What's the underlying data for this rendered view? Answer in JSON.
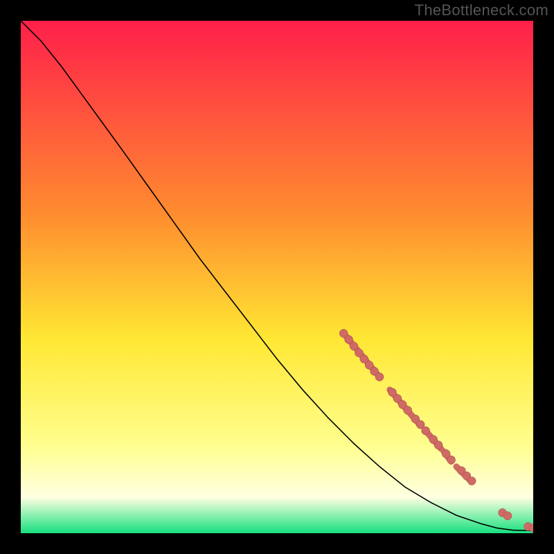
{
  "watermark": "TheBottleneck.com",
  "colors": {
    "background": "#000000",
    "curve": "#000000",
    "point_fill": "#cf6a64",
    "point_stroke": "#9f4e49",
    "grad_top": "#ff1f4a",
    "grad_mid1": "#ff8d2f",
    "grad_mid2": "#ffe733",
    "grad_mid3": "#ffff8f",
    "grad_mid4": "#ffffe2",
    "grad_bottom": "#16e07f"
  },
  "chart_data": {
    "type": "line",
    "title": "",
    "xlabel": "",
    "ylabel": "",
    "xlim": [
      0,
      100
    ],
    "ylim": [
      0,
      100
    ],
    "curve": [
      {
        "x": 0,
        "y": 100
      },
      {
        "x": 4,
        "y": 96
      },
      {
        "x": 8,
        "y": 91
      },
      {
        "x": 12,
        "y": 85.5
      },
      {
        "x": 16,
        "y": 80
      },
      {
        "x": 20,
        "y": 74.5
      },
      {
        "x": 25,
        "y": 67.5
      },
      {
        "x": 30,
        "y": 60.5
      },
      {
        "x": 35,
        "y": 53.5
      },
      {
        "x": 40,
        "y": 47
      },
      {
        "x": 45,
        "y": 40.5
      },
      {
        "x": 50,
        "y": 34
      },
      {
        "x": 55,
        "y": 28
      },
      {
        "x": 60,
        "y": 22.5
      },
      {
        "x": 65,
        "y": 17.5
      },
      {
        "x": 70,
        "y": 13
      },
      {
        "x": 75,
        "y": 9
      },
      {
        "x": 80,
        "y": 6
      },
      {
        "x": 85,
        "y": 3.5
      },
      {
        "x": 90,
        "y": 1.8
      },
      {
        "x": 93,
        "y": 1.0
      },
      {
        "x": 96,
        "y": 0.6
      },
      {
        "x": 100,
        "y": 0.5
      }
    ],
    "curve_thick_segments": [
      {
        "x1": 63,
        "y1": 39,
        "x2": 70,
        "y2": 30.5
      },
      {
        "x1": 72,
        "y1": 28,
        "x2": 78,
        "y2": 21
      },
      {
        "x1": 79,
        "y1": 20,
        "x2": 82,
        "y2": 16.5
      },
      {
        "x1": 82.5,
        "y1": 16,
        "x2": 84,
        "y2": 14
      },
      {
        "x1": 85,
        "y1": 13,
        "x2": 88,
        "y2": 10
      }
    ],
    "points": [
      {
        "x": 63,
        "y": 39
      },
      {
        "x": 64,
        "y": 37.8
      },
      {
        "x": 65,
        "y": 36.5
      },
      {
        "x": 66,
        "y": 35.2
      },
      {
        "x": 67,
        "y": 34
      },
      {
        "x": 68,
        "y": 32.8
      },
      {
        "x": 69,
        "y": 31.6
      },
      {
        "x": 70,
        "y": 30.5
      },
      {
        "x": 72.5,
        "y": 27.5
      },
      {
        "x": 73.5,
        "y": 26.3
      },
      {
        "x": 74.5,
        "y": 25.1
      },
      {
        "x": 75.5,
        "y": 24
      },
      {
        "x": 77,
        "y": 22.3
      },
      {
        "x": 78,
        "y": 21.2
      },
      {
        "x": 79,
        "y": 20
      },
      {
        "x": 80.5,
        "y": 18.3
      },
      {
        "x": 81.5,
        "y": 17.2
      },
      {
        "x": 83,
        "y": 15.5
      },
      {
        "x": 84,
        "y": 14.3
      },
      {
        "x": 86,
        "y": 12.2
      },
      {
        "x": 87,
        "y": 11.2
      },
      {
        "x": 88,
        "y": 10.2
      },
      {
        "x": 94,
        "y": 4.0
      },
      {
        "x": 95,
        "y": 3.4
      },
      {
        "x": 99,
        "y": 1.3
      },
      {
        "x": 100,
        "y": 1.0
      }
    ]
  }
}
